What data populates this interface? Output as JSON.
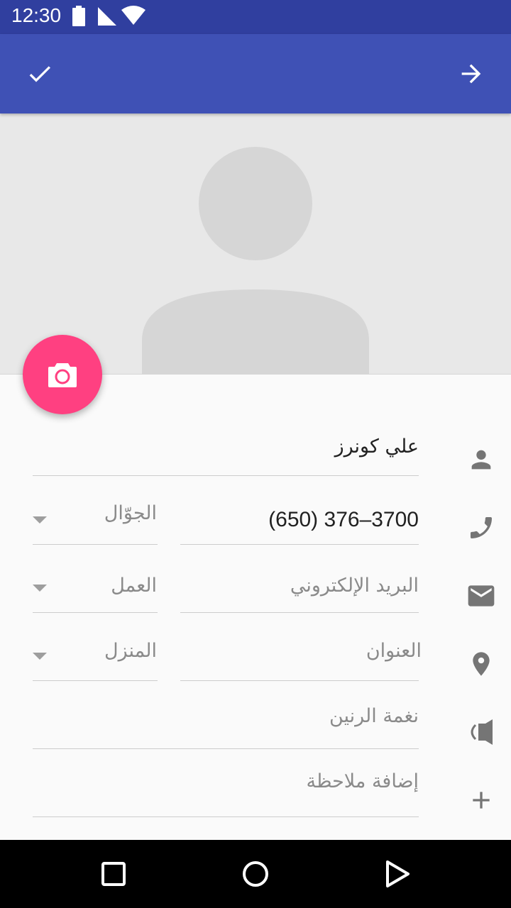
{
  "status_bar": {
    "time": "12:30",
    "icons": [
      "battery-icon",
      "signal-icon",
      "wifi-icon"
    ]
  },
  "app_bar": {
    "background": "#3f51b5",
    "left_action": "check-icon",
    "right_action": "arrow-forward-icon"
  },
  "photo": {
    "placeholder": "person-silhouette",
    "fab_icon": "camera-icon",
    "fab_color": "#ff4081"
  },
  "form": {
    "name": {
      "value": "علي كونرز",
      "icon": "person-icon"
    },
    "phone": {
      "value": "(650) 376–3700",
      "type": "الجوّال",
      "icon": "phone-icon"
    },
    "email": {
      "placeholder": "البريد الإلكتروني",
      "type": "العمل",
      "icon": "email-icon"
    },
    "address": {
      "placeholder": "العنوان",
      "type": "المنزل",
      "icon": "location-icon"
    },
    "ringtone": {
      "placeholder": "نغمة الرنين",
      "icon": "ringtone-icon"
    },
    "note": {
      "placeholder": "إضافة ملاحظة",
      "icon": "add-icon"
    }
  },
  "nav_bar": {
    "buttons": [
      "back-icon",
      "home-icon",
      "recents-icon"
    ]
  }
}
